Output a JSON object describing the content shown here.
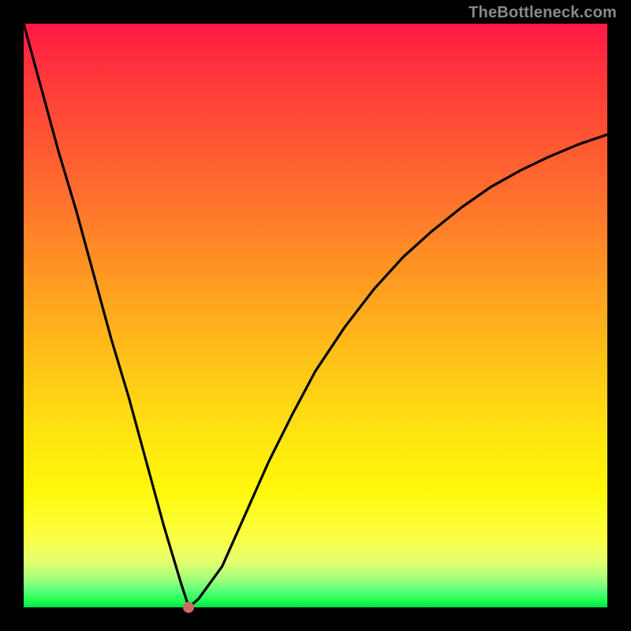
{
  "attribution": "TheBottleneck.com",
  "chart_data": {
    "type": "line",
    "title": "",
    "xlabel": "",
    "ylabel": "",
    "xlim": [
      0,
      1
    ],
    "ylim": [
      0,
      1
    ],
    "gradient_meaning": "Top red through orange to green at bottom (red=high bottleneck, green=optimal)",
    "series": [
      {
        "name": "bottleneck-curve",
        "x": [
          0.0,
          0.03,
          0.06,
          0.09,
          0.12,
          0.15,
          0.18,
          0.21,
          0.24,
          0.27,
          0.283,
          0.3,
          0.34,
          0.38,
          0.42,
          0.46,
          0.5,
          0.55,
          0.6,
          0.65,
          0.7,
          0.75,
          0.8,
          0.85,
          0.9,
          0.95,
          1.0
        ],
        "y": [
          1.0,
          0.89,
          0.78,
          0.68,
          0.57,
          0.46,
          0.36,
          0.25,
          0.14,
          0.04,
          0.0,
          0.015,
          0.07,
          0.16,
          0.25,
          0.33,
          0.405,
          0.48,
          0.545,
          0.6,
          0.645,
          0.685,
          0.72,
          0.748,
          0.772,
          0.793,
          0.81
        ]
      }
    ],
    "optimal_point": {
      "x": 0.283,
      "y": 0.0
    }
  }
}
